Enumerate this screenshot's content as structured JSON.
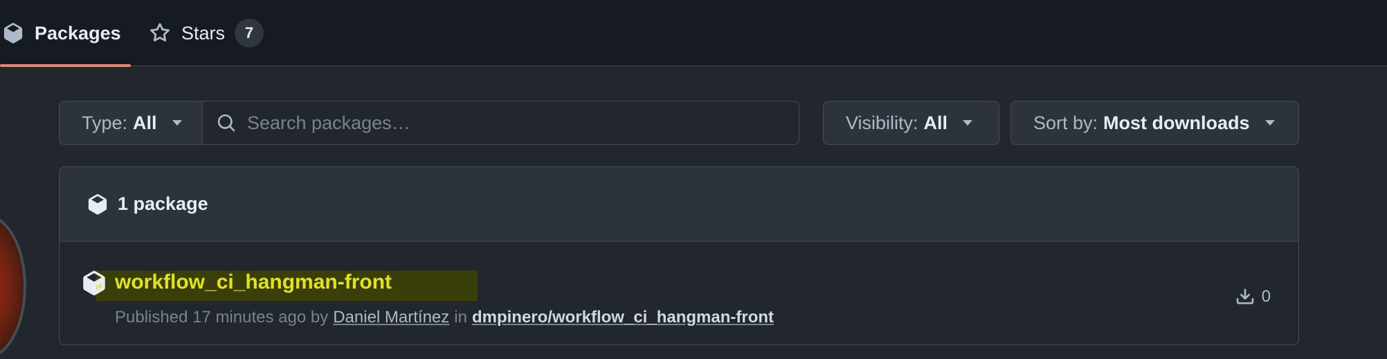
{
  "tabs": {
    "packages": {
      "label": "Packages",
      "icon": "package-icon"
    },
    "stars": {
      "label": "Stars",
      "icon": "star-icon",
      "count": "7"
    }
  },
  "filters": {
    "type": {
      "label": "Type:",
      "value": "All"
    },
    "search": {
      "placeholder": "Search packages…",
      "value": ""
    },
    "visibility": {
      "label": "Visibility:",
      "value": "All"
    },
    "sort": {
      "label": "Sort by:",
      "value": "Most downloads"
    }
  },
  "results": {
    "count_label": "1 package",
    "packages": [
      {
        "name": "workflow_ci_hangman-front",
        "published_prefix": "Published 17 minutes ago by",
        "author": "Daniel Martínez",
        "in_word": "in",
        "repository": "dmpinero/workflow_ci_hangman-front",
        "downloads": "0"
      }
    ]
  },
  "colors": {
    "accent_underline": "#f78166",
    "package_name": "#e3e21f",
    "background": "#22272e"
  }
}
